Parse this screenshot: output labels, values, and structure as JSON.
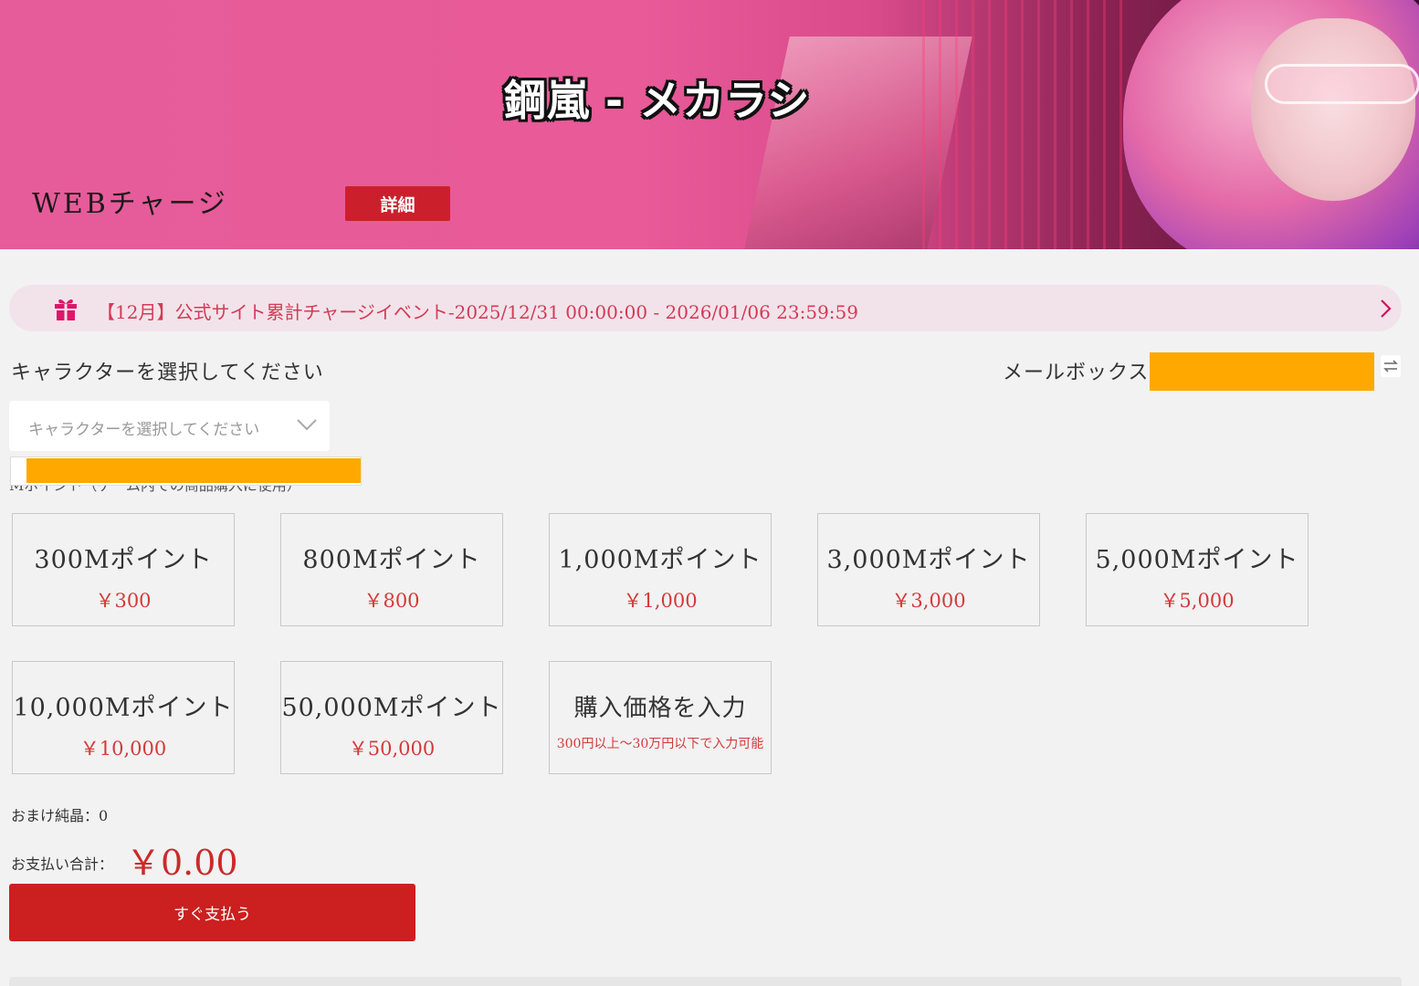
{
  "banner": {
    "game_title": "鋼嵐 - メカラシ",
    "page_title": "WEBチャージ",
    "detail_button": "詳細"
  },
  "event": {
    "text": "【12月】公式サイト累計チャージイベント-2025/12/31  00:00:00  -  2026/01/06  23:59:59",
    "icon": "gift-icon"
  },
  "character": {
    "label": "キャラクターを選択してください",
    "select_placeholder": "キャラクターを選択してください"
  },
  "mailbox": {
    "label": "メールボックス:"
  },
  "points_caption": "Mポイント（ゲーム内での商品購入に使用）",
  "options": [
    {
      "title": "300Mポイント",
      "price": "￥300"
    },
    {
      "title": "800Mポイント",
      "price": "￥800"
    },
    {
      "title": "1,000Mポイント",
      "price": "￥1,000"
    },
    {
      "title": "3,000Mポイント",
      "price": "￥3,000"
    },
    {
      "title": "5,000Mポイント",
      "price": "￥5,000"
    },
    {
      "title": "10,000Mポイント",
      "price": "￥10,000"
    },
    {
      "title": "50,000Mポイント",
      "price": "￥50,000"
    }
  ],
  "custom_option": {
    "title": "購入価格を入力",
    "note": "300円以上〜30万円以下で入力可能"
  },
  "summary": {
    "bonus_label": "おまけ純晶：0",
    "total_label": "お支払い合計：",
    "total_value": "￥0.00"
  },
  "pay_button": "すぐ支払う",
  "colors": {
    "accent": "#cc1f1f",
    "price": "#d43a3a",
    "redaction": "#ffa800"
  }
}
